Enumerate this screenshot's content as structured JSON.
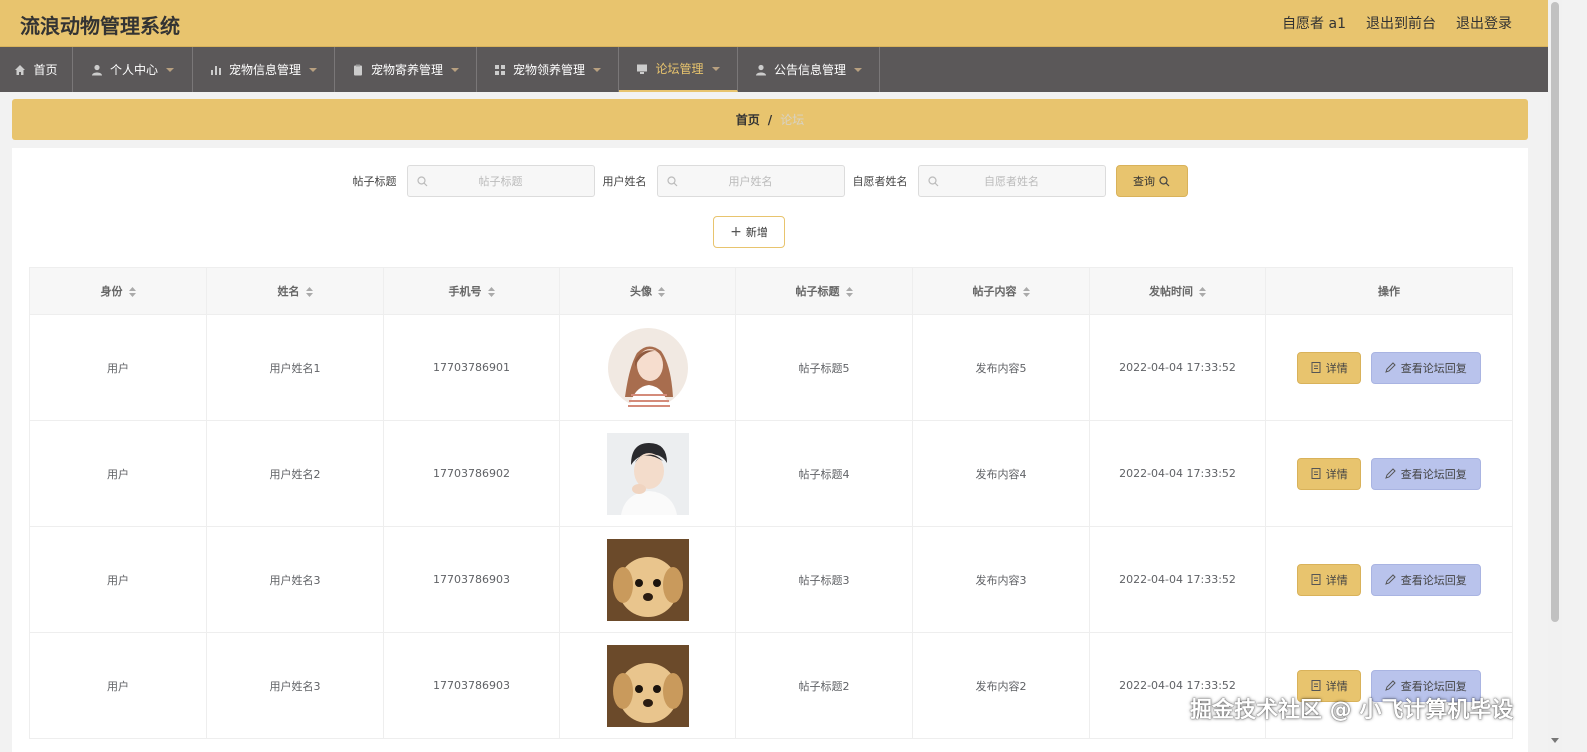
{
  "app": {
    "title": "流浪动物管理系统",
    "user_label": "自愿者 a1",
    "front_label": "退出到前台",
    "logout_label": "退出登录"
  },
  "nav": {
    "items": [
      {
        "label": "首页",
        "icon": "home-icon"
      },
      {
        "label": "个人中心",
        "icon": "user-icon"
      },
      {
        "label": "宠物信息管理",
        "icon": "bar-chart-icon"
      },
      {
        "label": "宠物寄养管理",
        "icon": "clipboard-icon"
      },
      {
        "label": "宠物领养管理",
        "icon": "grid-icon"
      },
      {
        "label": "论坛管理",
        "icon": "monitor-icon"
      },
      {
        "label": "公告信息管理",
        "icon": "user-icon"
      }
    ],
    "active_index": 5
  },
  "breadcrumb": {
    "home": "首页",
    "separator": "/",
    "current": "论坛"
  },
  "search": {
    "fields": [
      {
        "label": "帖子标题",
        "placeholder": "帖子标题"
      },
      {
        "label": "用户姓名",
        "placeholder": "用户姓名"
      },
      {
        "label": "自愿者姓名",
        "placeholder": "自愿者姓名"
      }
    ],
    "query_label": "查询"
  },
  "add_label": "新增",
  "table": {
    "columns": [
      "身份",
      "姓名",
      "手机号",
      "头像",
      "帖子标题",
      "帖子内容",
      "发帖时间",
      "操作"
    ],
    "rows": [
      {
        "role": "用户",
        "name": "用户姓名1",
        "phone": "17703786901",
        "avatar": "woman-avatar",
        "title": "帖子标题5",
        "content": "发布内容5",
        "time": "2022-04-04 17:33:52"
      },
      {
        "role": "用户",
        "name": "用户姓名2",
        "phone": "17703786902",
        "avatar": "man-avatar",
        "title": "帖子标题4",
        "content": "发布内容4",
        "time": "2022-04-04 17:33:52"
      },
      {
        "role": "用户",
        "name": "用户姓名3",
        "phone": "17703786903",
        "avatar": "puppy-avatar",
        "title": "帖子标题3",
        "content": "发布内容3",
        "time": "2022-04-04 17:33:52"
      },
      {
        "role": "用户",
        "name": "用户姓名3",
        "phone": "17703786903",
        "avatar": "puppy-avatar",
        "title": "帖子标题2",
        "content": "发布内容2",
        "time": "2022-04-04 17:33:52"
      }
    ],
    "detail_label": "详情",
    "reply_label": "查看论坛回复"
  },
  "watermark": "掘金技术社区 @ 小飞计算机毕设",
  "colors": {
    "accent": "#e8c46e",
    "nav_bg": "#5b5859",
    "reply_button": "#b9c3ec"
  }
}
